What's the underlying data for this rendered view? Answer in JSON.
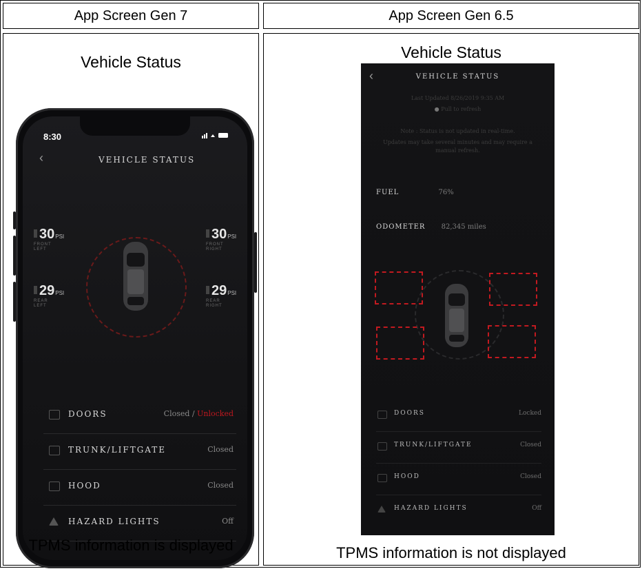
{
  "table": {
    "col1_header": "App Screen Gen 7",
    "col2_header": "App Screen Gen 6.5",
    "col1_caption": "TPMS information is displayed",
    "col2_caption": "TPMS information is not displayed"
  },
  "gen7": {
    "title": "Vehicle Status",
    "status_bar": {
      "time": "8:30",
      "icons": "signal wifi battery"
    },
    "screen_title": "VEHICLE STATUS",
    "tires": [
      {
        "value": "30",
        "unit": "PSI",
        "pos1": "FRONT",
        "pos2": "LEFT"
      },
      {
        "value": "30",
        "unit": "PSI",
        "pos1": "FRONT",
        "pos2": "RIGHT"
      },
      {
        "value": "29",
        "unit": "PSI",
        "pos1": "REAR",
        "pos2": "LEFT"
      },
      {
        "value": "29",
        "unit": "PSI",
        "pos1": "REAR",
        "pos2": "RIGHT"
      }
    ],
    "rows": [
      {
        "label": "DOORS",
        "value": "Closed / ",
        "value_alert": "Unlocked",
        "icon": "door-icon"
      },
      {
        "label": "TRUNK/LIFTGATE",
        "value": "Closed",
        "icon": "trunk-icon"
      },
      {
        "label": "HOOD",
        "value": "Closed",
        "icon": "hood-icon"
      },
      {
        "label": "HAZARD LIGHTS",
        "value": "Off",
        "icon": "hazard-icon"
      }
    ]
  },
  "gen65": {
    "title": "Vehicle Status",
    "screen_title": "VEHICLE STATUS",
    "last_updated": "Last Updated 8/26/2019 9:35 AM",
    "pull_refresh": "Pull to refresh",
    "note1": "Note : Status is not updated in real-time.",
    "note2": "Updates may take several minutes and may require a",
    "note3": "manual refresh.",
    "fuel_label": "FUEL",
    "fuel_value": "76%",
    "odometer_label": "ODOMETER",
    "odometer_value": "82,345 miles",
    "rows": [
      {
        "label": "DOORS",
        "value": "Locked",
        "icon": "door-icon"
      },
      {
        "label": "TRUNK/LIFTGATE",
        "value": "Closed",
        "icon": "trunk-icon"
      },
      {
        "label": "HOOD",
        "value": "Closed",
        "icon": "hood-icon"
      },
      {
        "label": "HAZARD LIGHTS",
        "value": "Off",
        "icon": "hazard-icon"
      }
    ]
  },
  "colors": {
    "alert_red": "#c0181f",
    "tpms_ring": "#6a1a1a",
    "placeholder_dash": "#c21a20"
  }
}
